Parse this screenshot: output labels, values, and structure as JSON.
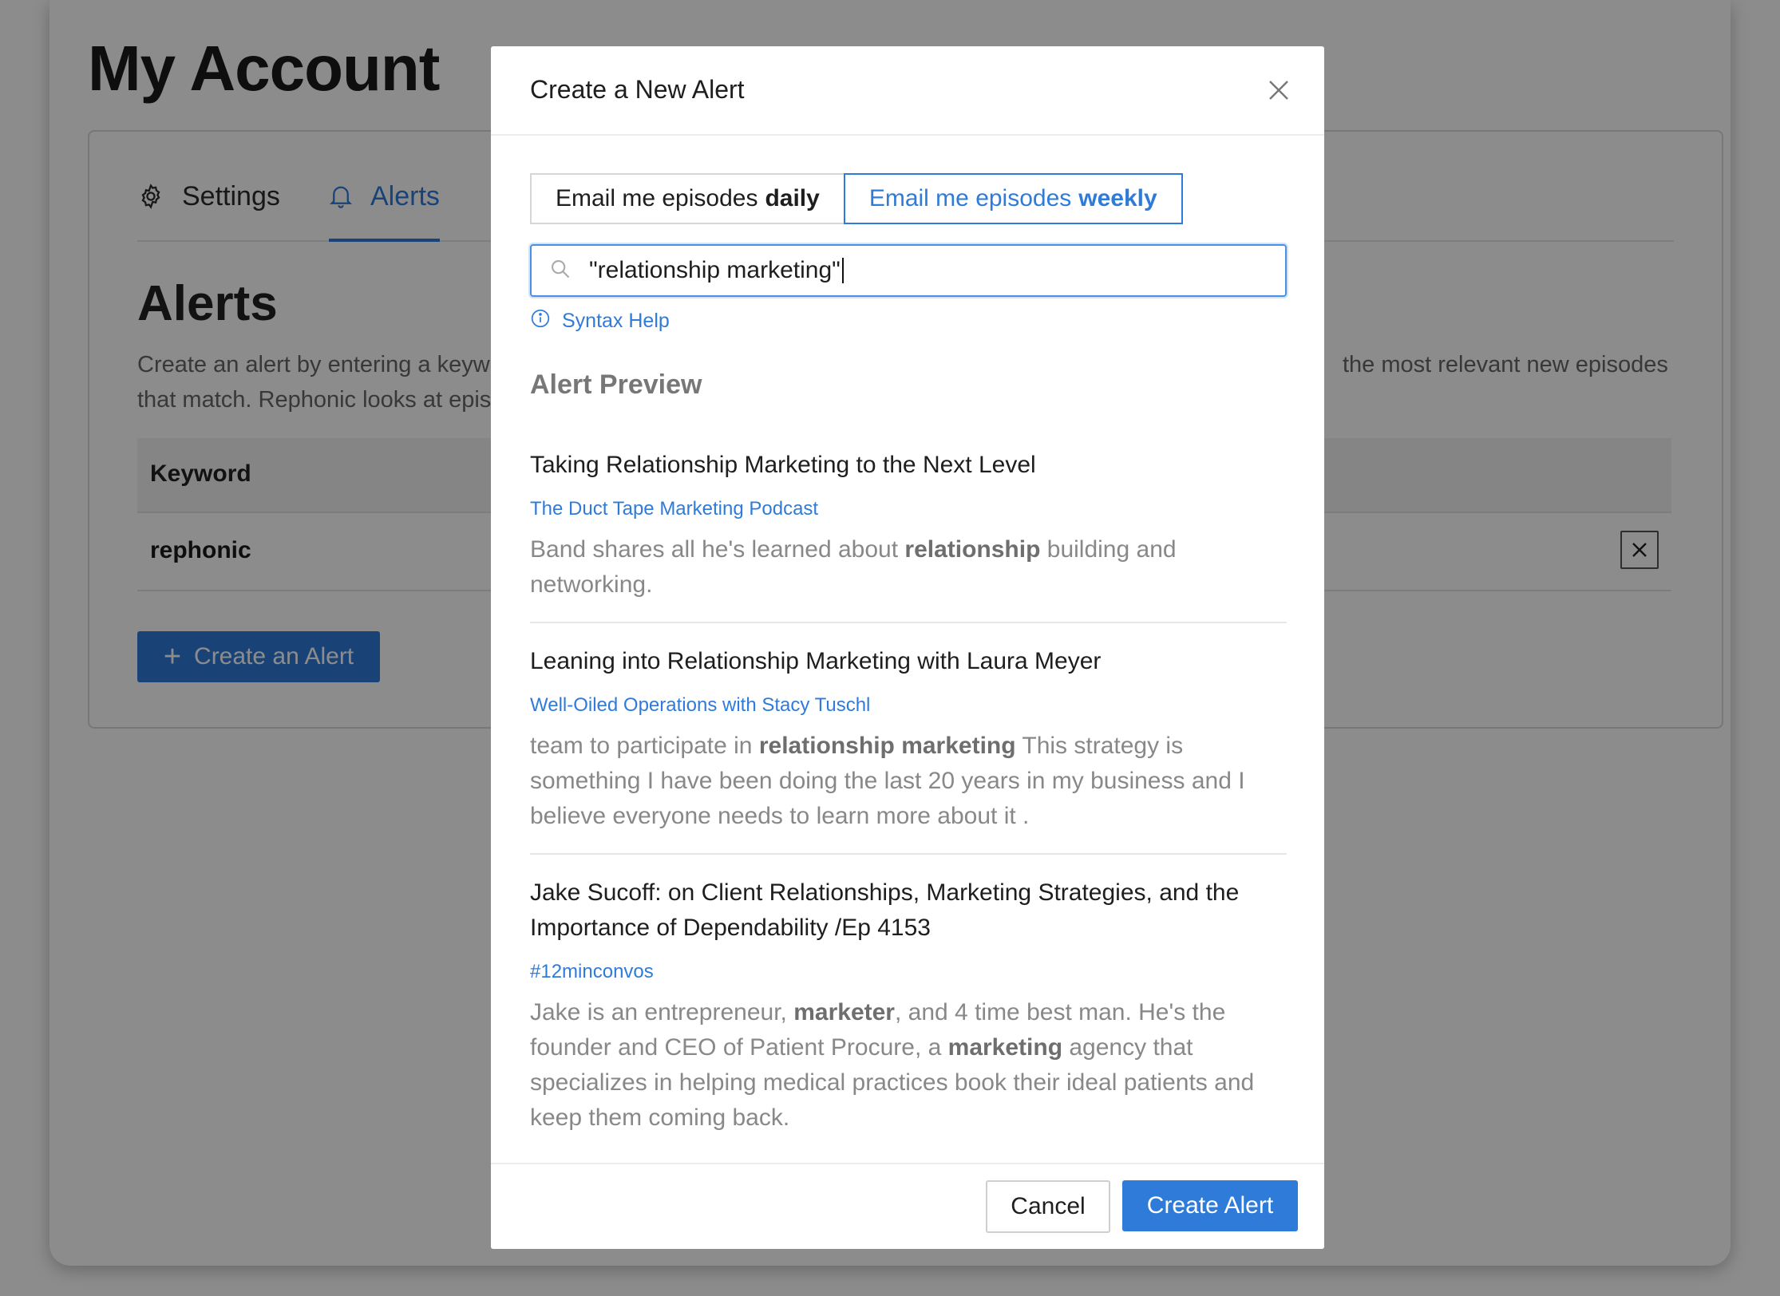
{
  "page": {
    "title": "My Account"
  },
  "tabs": {
    "settings_label": "Settings",
    "alerts_label": "Alerts"
  },
  "alerts_section": {
    "heading": "Alerts",
    "description_left": "Create an alert by entering a keyw",
    "description_left_line2": "that match. Rephonic looks at epis",
    "description_right": "the most relevant new episodes",
    "table_header": "Keyword",
    "keywords": [
      "rephonic"
    ],
    "create_button_label": "Create an Alert"
  },
  "modal": {
    "title": "Create a New Alert",
    "frequency": {
      "daily_prefix": "Email me episodes",
      "daily_strong": "daily",
      "weekly_prefix": "Email me episodes",
      "weekly_strong": "weekly",
      "selected": "weekly"
    },
    "search": {
      "value": "\"relationship marketing\""
    },
    "syntax_help_label": "Syntax Help",
    "preview_title": "Alert Preview",
    "results": [
      {
        "title": "Taking Relationship Marketing to the Next Level",
        "podcast": "The Duct Tape Marketing Podcast",
        "snippet_parts": [
          {
            "t": "Band shares all he's learned about ",
            "b": false
          },
          {
            "t": "relationship",
            "b": true
          },
          {
            "t": " building and networking.",
            "b": false
          }
        ]
      },
      {
        "title": "Leaning into Relationship Marketing with Laura Meyer",
        "podcast": "Well-Oiled Operations with Stacy Tuschl",
        "snippet_parts": [
          {
            "t": "team to participate in ",
            "b": false
          },
          {
            "t": "relationship marketing",
            "b": true
          },
          {
            "t": " This strategy is something I have been doing the last 20 years in my business and I believe everyone needs to learn more about it .",
            "b": false
          }
        ]
      },
      {
        "title": "Jake Sucoff: on Client Relationships, Marketing Strategies, and the Importance of Dependability /Ep 4153",
        "podcast": "#12minconvos",
        "snippet_parts": [
          {
            "t": "Jake is an entrepreneur, ",
            "b": false
          },
          {
            "t": "marketer",
            "b": true
          },
          {
            "t": ", and 4 time best man. He's the founder and CEO of Patient Procure, a ",
            "b": false
          },
          {
            "t": "marketing",
            "b": true
          },
          {
            "t": " agency that specializes in helping medical practices book their ideal patients and keep them coming back.",
            "b": false
          }
        ]
      }
    ],
    "cancel_label": "Cancel",
    "create_label": "Create Alert"
  },
  "colors": {
    "accent": "#2f7bd9",
    "overlay": "rgba(0,0,0,0.45)"
  },
  "icons": [
    "gear-icon",
    "bell-icon",
    "close-icon",
    "search-icon",
    "info-icon",
    "plus-icon"
  ]
}
